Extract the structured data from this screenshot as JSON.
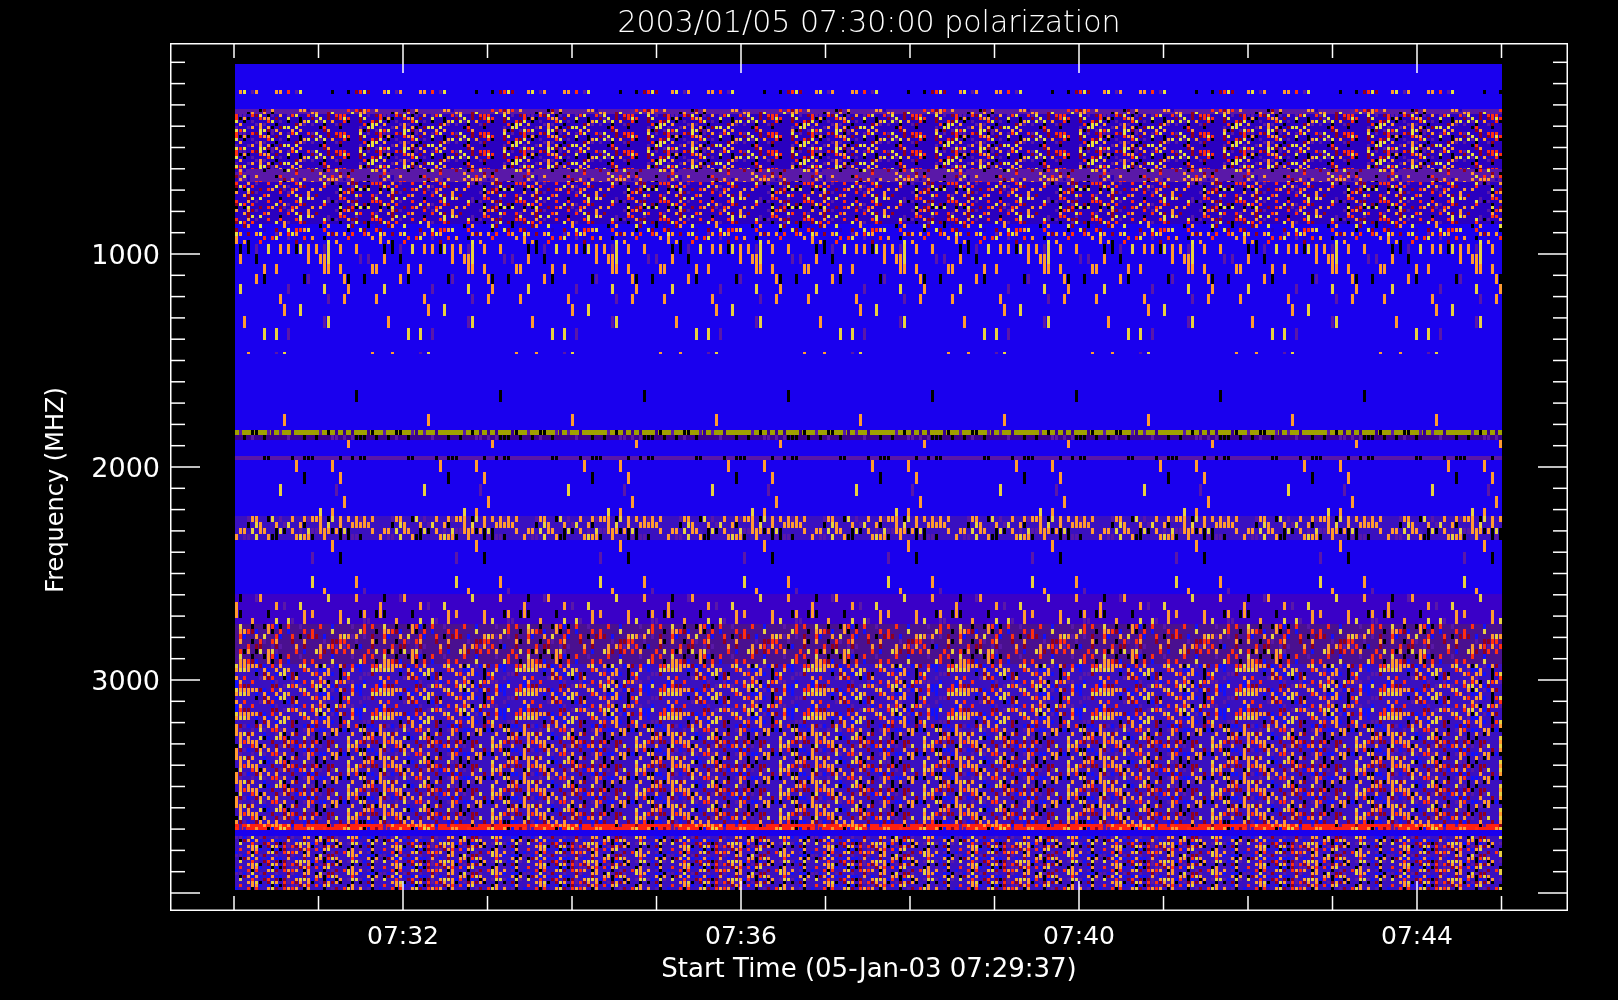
{
  "title": "2003/01/05 07:30:00 polarization",
  "y_axis": {
    "label": "Frequency (MHZ)",
    "ticks": [
      "1000",
      "2000",
      "3000"
    ]
  },
  "x_axis": {
    "label": "Start Time (05-Jan-03 07:29:37)",
    "ticks": [
      "07:32",
      "07:36",
      "07:40",
      "07:44"
    ]
  }
}
